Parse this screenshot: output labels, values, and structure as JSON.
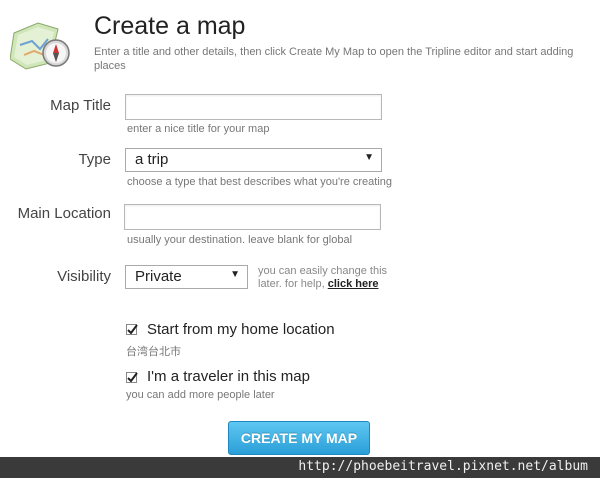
{
  "header": {
    "title": "Create a map",
    "subtitle": "Enter a title and other details, then click Create My Map to open the Tripline editor and start adding places"
  },
  "form": {
    "map_title": {
      "label": "Map Title",
      "value": "",
      "hint": "enter a nice title for your map"
    },
    "type": {
      "label": "Type",
      "value": "a trip",
      "hint": "choose a type that best describes what you're creating"
    },
    "main_location": {
      "label": "Main Location",
      "value": "",
      "hint": "usually your destination. leave blank for global"
    },
    "visibility": {
      "label": "Visibility",
      "value": "Private",
      "help_text": "you can easily change this later. for help,",
      "help_link": "click here"
    },
    "home_location": {
      "label": "Start from my home location",
      "checked": true,
      "hint": "台湾台北市"
    },
    "traveler": {
      "label": "I'm a traveler in this map",
      "checked": true,
      "hint": "you can add more people later"
    },
    "submit_label": "CREATE MY MAP"
  },
  "watermark": "http://phoebeitravel.pixnet.net/album",
  "colors": {
    "button": "#2a9fd8",
    "watermark_bar": "#3a3a3a"
  },
  "icons": {
    "logo": "map-compass-icon",
    "select_arrow": "dropdown-arrow-icon",
    "checkbox": "checkmark-icon"
  }
}
